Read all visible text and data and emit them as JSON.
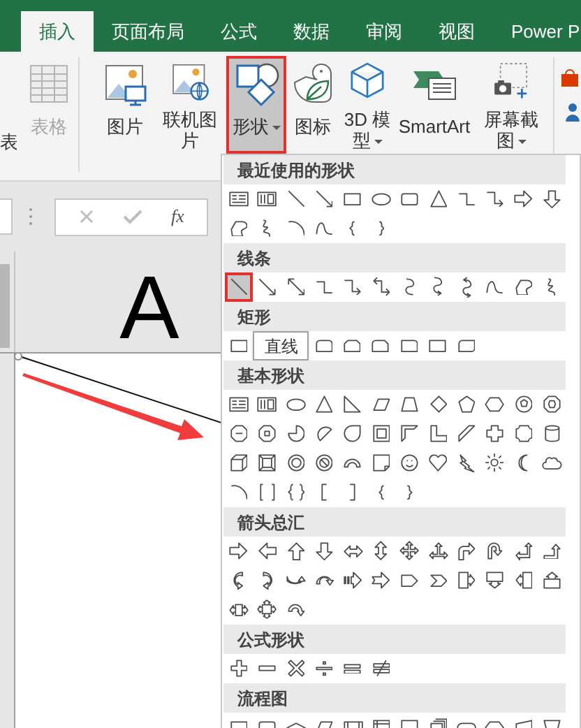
{
  "tabs": [
    {
      "label": "插入",
      "selected": true
    },
    {
      "label": "页面布局",
      "selected": false
    },
    {
      "label": "公式",
      "selected": false
    },
    {
      "label": "数据",
      "selected": false
    },
    {
      "label": "审阅",
      "selected": false
    },
    {
      "label": "视图",
      "selected": false
    },
    {
      "label": "Power P",
      "selected": false
    }
  ],
  "ribbon": {
    "cut_label": "表",
    "buttons": [
      {
        "kind": "table",
        "label": "表格",
        "disabled": true,
        "selected": false,
        "dropdown": false
      },
      {
        "kind": "picture",
        "label": "图片",
        "disabled": false,
        "selected": false,
        "dropdown": false
      },
      {
        "kind": "online-picture",
        "label": "联机图片",
        "disabled": false,
        "selected": false,
        "dropdown": false
      },
      {
        "kind": "shapes",
        "label": "形状",
        "disabled": false,
        "selected": true,
        "dropdown": true
      },
      {
        "kind": "icons",
        "label": "图标",
        "disabled": false,
        "selected": false,
        "dropdown": false
      },
      {
        "kind": "model",
        "label": "3D 模型",
        "disabled": false,
        "selected": false,
        "dropdown": true
      },
      {
        "kind": "smartart",
        "label": "SmartArt",
        "disabled": false,
        "selected": false,
        "dropdown": false
      },
      {
        "kind": "screenshot",
        "label": "屏幕截图",
        "disabled": false,
        "selected": false,
        "dropdown": true
      }
    ]
  },
  "formula_bar": {
    "fx": "fx"
  },
  "sheet": {
    "column_header": "A"
  },
  "shapes_menu": {
    "sections": [
      {
        "title": "最近使用的形状",
        "rows": [
          [
            {
              "kind": "textbox",
              "selected": false
            },
            {
              "kind": "vtextbox",
              "selected": false
            },
            {
              "kind": "line",
              "selected": false
            },
            {
              "kind": "arrow-line",
              "selected": false
            },
            {
              "kind": "rect",
              "selected": false
            },
            {
              "kind": "oval",
              "selected": false
            },
            {
              "kind": "rounded-rect",
              "selected": false
            },
            {
              "kind": "triangle",
              "selected": false
            },
            {
              "kind": "elbow",
              "selected": false
            },
            {
              "kind": "elbow-arrow",
              "selected": false
            },
            {
              "kind": "arrow-right",
              "selected": false
            },
            {
              "kind": "arrow-down",
              "selected": false
            }
          ],
          [
            {
              "kind": "freeform",
              "selected": false
            },
            {
              "kind": "scribble",
              "selected": false
            },
            {
              "kind": "arc",
              "selected": false
            },
            {
              "kind": "curve",
              "selected": false
            },
            {
              "kind": "left-brace",
              "selected": false
            },
            {
              "kind": "right-brace",
              "selected": false
            }
          ]
        ]
      },
      {
        "title": "线条",
        "rows": [
          [
            {
              "kind": "line",
              "selected": true
            },
            {
              "kind": "arrow-line",
              "selected": false
            },
            {
              "kind": "double-arrow",
              "selected": false
            },
            {
              "kind": "elbow",
              "selected": false
            },
            {
              "kind": "elbow-arrow",
              "selected": false
            },
            {
              "kind": "elbow-double-arrow",
              "selected": false
            },
            {
              "kind": "curve-connector",
              "selected": false
            },
            {
              "kind": "curve-arrow",
              "selected": false
            },
            {
              "kind": "curve-double-arrow",
              "selected": false
            },
            {
              "kind": "curve",
              "selected": false
            },
            {
              "kind": "freeform",
              "selected": false
            },
            {
              "kind": "scribble",
              "selected": false
            }
          ]
        ]
      },
      {
        "title": "矩形",
        "tooltip": "直线",
        "rows": [
          [
            {
              "kind": "rect",
              "selected": false
            },
            {
              "kind": "round-same",
              "selected": false
            },
            {
              "kind": "snip-same",
              "selected": false
            },
            {
              "kind": "snip-round",
              "selected": false
            },
            {
              "kind": "round-corner",
              "selected": false
            },
            {
              "kind": "rect",
              "selected": false
            },
            {
              "kind": "round-diag",
              "selected": false
            }
          ]
        ]
      },
      {
        "title": "基本形状",
        "rows": [
          [
            {
              "kind": "textbox",
              "selected": false
            },
            {
              "kind": "vtextbox",
              "selected": false
            },
            {
              "kind": "oval",
              "selected": false
            },
            {
              "kind": "triangle",
              "selected": false
            },
            {
              "kind": "right-triangle",
              "selected": false
            },
            {
              "kind": "parallelogram",
              "selected": false
            },
            {
              "kind": "trapezoid",
              "selected": false
            },
            {
              "kind": "diamond",
              "selected": false
            },
            {
              "kind": "pentagon",
              "selected": false
            },
            {
              "kind": "hexagon",
              "selected": false
            },
            {
              "kind": "heptagon",
              "selected": false
            },
            {
              "kind": "octagon",
              "selected": false
            }
          ],
          [
            {
              "kind": "decagon",
              "selected": false
            },
            {
              "kind": "dodecagon",
              "selected": false
            },
            {
              "kind": "pie",
              "selected": false
            },
            {
              "kind": "chord",
              "selected": false
            },
            {
              "kind": "teardrop",
              "selected": false
            },
            {
              "kind": "frame",
              "selected": false
            },
            {
              "kind": "half-frame",
              "selected": false
            },
            {
              "kind": "l-shape",
              "selected": false
            },
            {
              "kind": "diagonal-stripe",
              "selected": false
            },
            {
              "kind": "cross",
              "selected": false
            },
            {
              "kind": "plaque",
              "selected": false
            },
            {
              "kind": "can",
              "selected": false
            }
          ],
          [
            {
              "kind": "cube",
              "selected": false
            },
            {
              "kind": "bevel",
              "selected": false
            },
            {
              "kind": "donut",
              "selected": false
            },
            {
              "kind": "no-symbol",
              "selected": false
            },
            {
              "kind": "block-arc",
              "selected": false
            },
            {
              "kind": "folded-corner",
              "selected": false
            },
            {
              "kind": "smiley",
              "selected": false
            },
            {
              "kind": "heart",
              "selected": false
            },
            {
              "kind": "lightning",
              "selected": false
            },
            {
              "kind": "sun",
              "selected": false
            },
            {
              "kind": "moon",
              "selected": false
            },
            {
              "kind": "cloud",
              "selected": false
            }
          ],
          [
            {
              "kind": "arc",
              "selected": false
            },
            {
              "kind": "double-bracket",
              "selected": false
            },
            {
              "kind": "double-brace",
              "selected": false
            },
            {
              "kind": "left-bracket",
              "selected": false
            },
            {
              "kind": "right-bracket",
              "selected": false
            },
            {
              "kind": "left-brace",
              "selected": false
            },
            {
              "kind": "right-brace",
              "selected": false
            }
          ]
        ]
      },
      {
        "title": "箭头总汇",
        "rows": [
          [
            {
              "kind": "arrow-right",
              "selected": false
            },
            {
              "kind": "arrow-left",
              "selected": false
            },
            {
              "kind": "arrow-up",
              "selected": false
            },
            {
              "kind": "arrow-down",
              "selected": false
            },
            {
              "kind": "arrow-left-right",
              "selected": false
            },
            {
              "kind": "arrow-up-down",
              "selected": false
            },
            {
              "kind": "arrow-quad",
              "selected": false
            },
            {
              "kind": "arrow-left-right-up",
              "selected": false
            },
            {
              "kind": "bent-arrow",
              "selected": false
            },
            {
              "kind": "u-turn-arrow",
              "selected": false
            },
            {
              "kind": "left-up-arrow",
              "selected": false
            },
            {
              "kind": "bent-up-arrow",
              "selected": false
            }
          ],
          [
            {
              "kind": "curved-right-arrow",
              "selected": false
            },
            {
              "kind": "curved-left-arrow",
              "selected": false
            },
            {
              "kind": "curved-up-arrow",
              "selected": false
            },
            {
              "kind": "curved-down-arrow",
              "selected": false
            },
            {
              "kind": "striped-right-arrow",
              "selected": false
            },
            {
              "kind": "notched-right-arrow",
              "selected": false
            },
            {
              "kind": "pentagon-arrow",
              "selected": false
            },
            {
              "kind": "chevron",
              "selected": false
            },
            {
              "kind": "right-callout",
              "selected": false
            },
            {
              "kind": "down-callout",
              "selected": false
            },
            {
              "kind": "left-callout",
              "selected": false
            },
            {
              "kind": "up-callout",
              "selected": false
            }
          ],
          [
            {
              "kind": "left-right-callout",
              "selected": false
            },
            {
              "kind": "quad-callout",
              "selected": false
            },
            {
              "kind": "circular-arrow",
              "selected": false
            }
          ]
        ]
      },
      {
        "title": "公式形状",
        "rows": [
          [
            {
              "kind": "plus",
              "selected": false
            },
            {
              "kind": "minus",
              "selected": false
            },
            {
              "kind": "multiply",
              "selected": false
            },
            {
              "kind": "divide",
              "selected": false
            },
            {
              "kind": "equal",
              "selected": false
            },
            {
              "kind": "not-equal",
              "selected": false
            }
          ]
        ]
      },
      {
        "title": "流程图",
        "rows": [
          [
            {
              "kind": "flow-process",
              "selected": false
            },
            {
              "kind": "flow-alternate",
              "selected": false
            },
            {
              "kind": "flow-decision",
              "selected": false
            },
            {
              "kind": "flow-data",
              "selected": false
            },
            {
              "kind": "flow-predefined",
              "selected": false
            },
            {
              "kind": "flow-internal",
              "selected": false
            },
            {
              "kind": "flow-document",
              "selected": false
            },
            {
              "kind": "flow-multidoc",
              "selected": false
            },
            {
              "kind": "flow-terminator",
              "selected": false
            },
            {
              "kind": "flow-preparation",
              "selected": false
            },
            {
              "kind": "flow-manual-input",
              "selected": false
            },
            {
              "kind": "flow-manual-op",
              "selected": false
            }
          ]
        ]
      }
    ]
  }
}
